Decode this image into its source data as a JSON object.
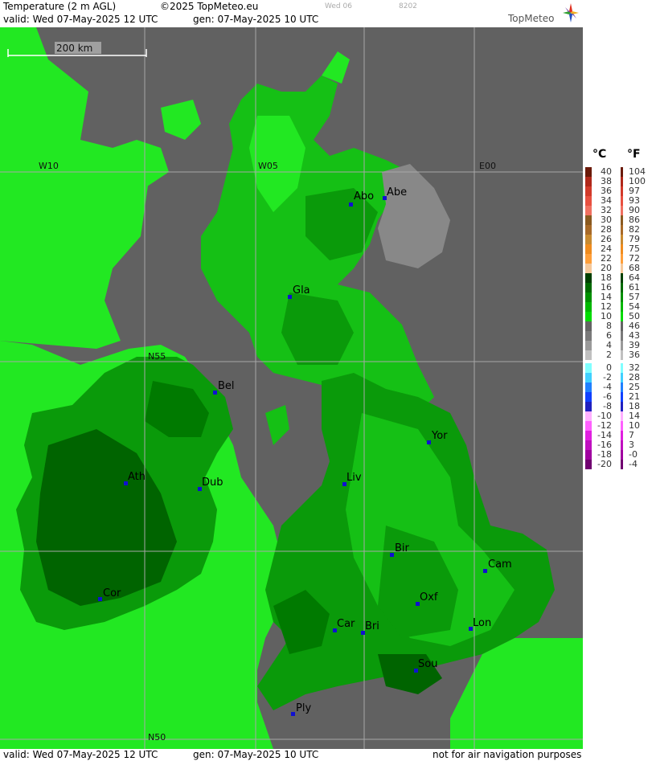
{
  "header": {
    "title": "Temperature (2 m AGL)",
    "copyright": "©2025 TopMeteo.eu",
    "day_tab": "Wed 06",
    "code": "8202",
    "valid": "valid:  Wed  07-May-2025  12 UTC",
    "gen": "gen: 07-May-2025 10 UTC",
    "brand": "TopMeteo"
  },
  "footer": {
    "valid": "valid:  Wed  07-May-2025  12 UTC",
    "gen": "gen: 07-May-2025 10 UTC",
    "disclaimer": "not for air navigation purposes"
  },
  "map": {
    "scale_label": "200 km",
    "grid_labels": {
      "w10": "W10",
      "w05": "W05",
      "e00": "E00",
      "n55": "N55",
      "n50": "N50"
    },
    "cities": [
      {
        "label": "Abo"
      },
      {
        "label": "Abe"
      },
      {
        "label": "Gla"
      },
      {
        "label": "Bel"
      },
      {
        "label": "Yor"
      },
      {
        "label": "Ath"
      },
      {
        "label": "Dub"
      },
      {
        "label": "Liv"
      },
      {
        "label": "Bir"
      },
      {
        "label": "Cam"
      },
      {
        "label": "Cor"
      },
      {
        "label": "Oxf"
      },
      {
        "label": "Car"
      },
      {
        "label": "Bri"
      },
      {
        "label": "Lon"
      },
      {
        "label": "Sou"
      },
      {
        "label": "Ply"
      }
    ],
    "colors": {
      "sea_warm": "#22e822",
      "land_dark": "#006400",
      "land_mid": "#0a9a0a",
      "land_light": "#15c015",
      "cold_water": "#888888",
      "grey_bg": "#616161"
    }
  },
  "legend": {
    "celsius_header": "°C",
    "fahrenheit_header": "°F",
    "celsius": [
      "40",
      "38",
      "36",
      "34",
      "32",
      "30",
      "28",
      "26",
      "24",
      "22",
      "20",
      "18",
      "16",
      "14",
      "12",
      "10",
      "8",
      "6",
      "4",
      "2",
      "0",
      "-2",
      "-4",
      "-6",
      "-8",
      "-10",
      "-12",
      "-14",
      "-16",
      "-18",
      "-20"
    ],
    "fahrenheit": [
      "104",
      "100",
      "97",
      "93",
      "90",
      "86",
      "82",
      "79",
      "75",
      "72",
      "68",
      "64",
      "61",
      "57",
      "54",
      "50",
      "46",
      "43",
      "39",
      "36",
      "32",
      "28",
      "25",
      "21",
      "18",
      "14",
      "10",
      "7",
      "3",
      "-0",
      "-4"
    ],
    "colors": [
      "#6b1a0a",
      "#b0281a",
      "#d23a2a",
      "#e85040",
      "#f07060",
      "#8a5a20",
      "#a86a28",
      "#c88a30",
      "#f08c1e",
      "#ff9f3a",
      "#f5c89a",
      "#004000",
      "#006a00",
      "#009000",
      "#00b800",
      "#00dc00",
      "#646464",
      "#7a7a7a",
      "#9a9a9a",
      "#c0c0c0",
      "#80ffff",
      "#40d0ff",
      "#2080ff",
      "#1040ff",
      "#2020c0",
      "#ffb0ff",
      "#ff60ff",
      "#e020e0",
      "#c010c0",
      "#a000a0",
      "#700070"
    ]
  }
}
